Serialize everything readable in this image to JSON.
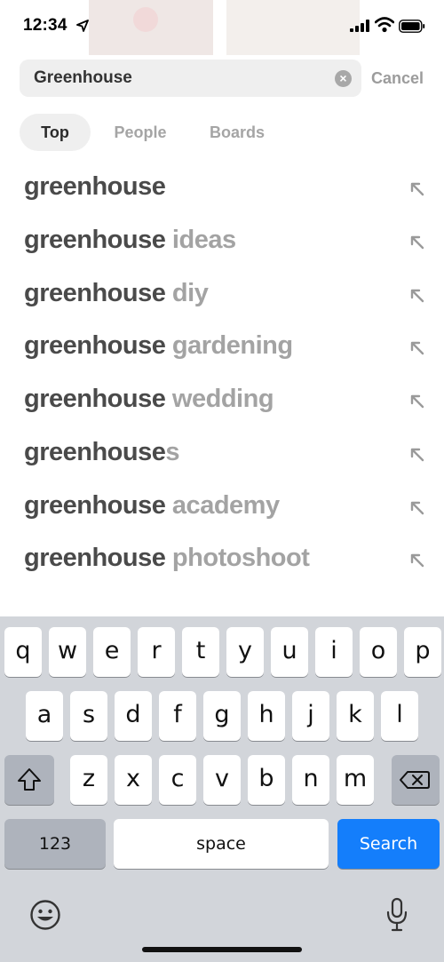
{
  "status_bar": {
    "time": "12:34"
  },
  "search": {
    "query": "Greenhouse",
    "cancel_label": "Cancel"
  },
  "tabs": [
    {
      "label": "Top",
      "active": true
    },
    {
      "label": "People",
      "active": false
    },
    {
      "label": "Boards",
      "active": false
    }
  ],
  "suggestions": [
    {
      "query_part": "greenhouse",
      "rest": ""
    },
    {
      "query_part": "greenhouse",
      "rest": " ideas"
    },
    {
      "query_part": "greenhouse",
      "rest": " diy"
    },
    {
      "query_part": "greenhouse",
      "rest": " gardening"
    },
    {
      "query_part": "greenhouse",
      "rest": " wedding"
    },
    {
      "query_part": "greenhouse",
      "rest": "s"
    },
    {
      "query_part": "greenhouse",
      "rest": " academy"
    },
    {
      "query_part": "greenhouse",
      "rest": " photoshoot"
    }
  ],
  "keyboard": {
    "row1": [
      "q",
      "w",
      "e",
      "r",
      "t",
      "y",
      "u",
      "i",
      "o",
      "p"
    ],
    "row2": [
      "a",
      "s",
      "d",
      "f",
      "g",
      "h",
      "j",
      "k",
      "l"
    ],
    "row3": [
      "z",
      "x",
      "c",
      "v",
      "b",
      "n",
      "m"
    ],
    "numbers_label": "123",
    "space_label": "space",
    "search_label": "Search"
  },
  "icons": {
    "location": "location-arrow-icon",
    "signal": "cellular-signal-icon",
    "wifi": "wifi-icon",
    "battery": "battery-icon",
    "clear": "clear-icon",
    "fill": "fill-arrow-icon",
    "shift": "shift-icon",
    "delete": "delete-icon",
    "emoji": "emoji-icon",
    "mic": "microphone-icon"
  },
  "colors": {
    "accent": "#147efb",
    "keyboard_bg": "#d2d5da"
  }
}
